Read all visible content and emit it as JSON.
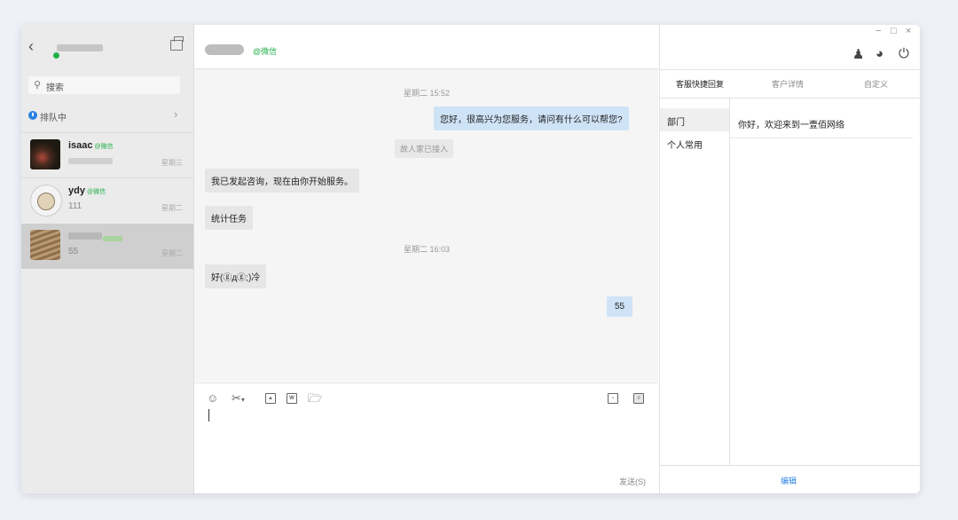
{
  "sidebar": {
    "search_placeholder": "搜索",
    "queue_label": "排队中",
    "conversations": [
      {
        "name": "isaac",
        "tag": "@微信",
        "preview": "",
        "day": "星期三"
      },
      {
        "name": "ydy",
        "tag": "@微信",
        "preview": "111",
        "day": "星期二"
      },
      {
        "name": "",
        "tag": "",
        "preview": "55",
        "day": "星期二"
      }
    ]
  },
  "chat": {
    "header_tag": "@微信",
    "messages": [
      {
        "type": "time",
        "text": "星期二 15:52"
      },
      {
        "type": "out",
        "text": "您好，很高兴为您服务，请问有什么可以帮您?"
      },
      {
        "type": "system",
        "text": "故人家已接入"
      },
      {
        "type": "in",
        "text": "我已发起咨询，现在由你开始服务。"
      },
      {
        "type": "in",
        "text": "统计任务"
      },
      {
        "type": "time",
        "text": "星期二 16:03"
      },
      {
        "type": "in",
        "text": "好(ⓖдⓖ;)冷"
      },
      {
        "type": "out",
        "text": "55"
      }
    ],
    "send_label": "发送(S)"
  },
  "right_panel": {
    "window_controls": [
      "−",
      "□",
      "×"
    ],
    "tabs": [
      "客服快捷回复",
      "客户详情",
      "自定义"
    ],
    "categories": [
      "部门",
      "个人常用"
    ],
    "reply_text": "你好，欢迎来到一壹佰网络",
    "edit_label": "编辑"
  },
  "colors": {
    "accent_blue": "#2a82e4",
    "online_green": "#22b04b",
    "outgoing_bubble": "#cfe3f7",
    "incoming_bubble": "#e6e6e6"
  }
}
